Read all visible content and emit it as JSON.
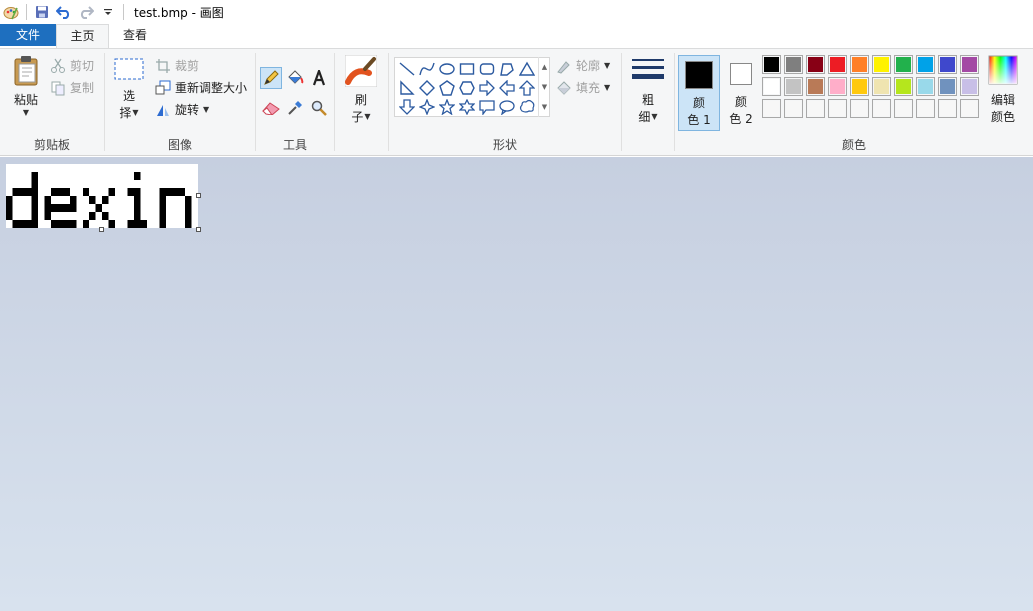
{
  "window": {
    "title": "test.bmp - 画图"
  },
  "tabs": [
    {
      "label": "文件"
    },
    {
      "label": "主页"
    },
    {
      "label": "查看"
    }
  ],
  "clipboard": {
    "paste": "粘贴",
    "cut": "剪切",
    "copy": "复制",
    "group_label": "剪贴板"
  },
  "image": {
    "select_line1": "选",
    "select_line2": "择",
    "crop": "裁剪",
    "resize": "重新调整大小",
    "rotate": "旋转",
    "group_label": "图像"
  },
  "tools": {
    "group_label": "工具"
  },
  "brushes": {
    "line1": "刷",
    "line2": "子"
  },
  "shapes": {
    "outline": "轮廓",
    "fill": "填充",
    "group_label": "形状"
  },
  "size": {
    "line1": "粗",
    "line2": "细"
  },
  "colors": {
    "color1_line1": "颜",
    "color1_line2": "色 1",
    "color2_line1": "颜",
    "color2_line2": "色 2",
    "edit_line1": "编辑",
    "edit_line2": "颜色",
    "group_label": "颜色",
    "color1": "#000000",
    "color2": "#ffffff",
    "palette_row1": [
      "#000000",
      "#7f7f7f",
      "#880015",
      "#ed1c24",
      "#ff7f27",
      "#fff200",
      "#22b14c",
      "#00a2e8",
      "#3f48cc",
      "#a349a4"
    ],
    "palette_row2": [
      "#ffffff",
      "#c3c3c3",
      "#b97a57",
      "#ffaec9",
      "#ffc90e",
      "#efe4b0",
      "#b5e61d",
      "#99d9ea",
      "#7092be",
      "#c8bfe7"
    ],
    "palette_row3": [
      "#f7f7f7",
      "#f7f7f7",
      "#f7f7f7",
      "#f7f7f7",
      "#f7f7f7",
      "#f7f7f7",
      "#f7f7f7",
      "#f7f7f7",
      "#f7f7f7",
      "#f7f7f7"
    ]
  },
  "canvas": {
    "text": "dexin"
  }
}
